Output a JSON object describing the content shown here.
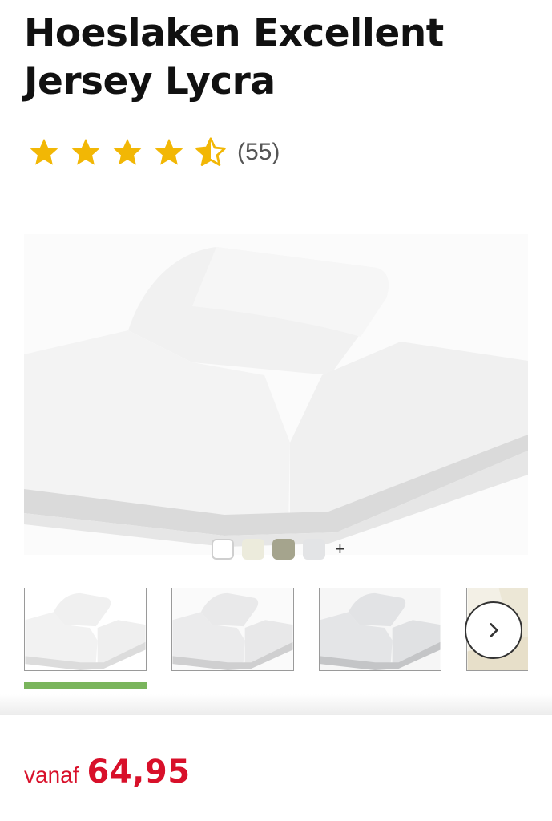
{
  "product": {
    "title_line_1": "Hoeslaken Excellent",
    "title_line_2": "Jersey Lycra"
  },
  "rating": {
    "stars": 4.5,
    "max_stars": 5,
    "count": "(55)",
    "star_color": "#f2b705"
  },
  "colors": {
    "swatches": [
      {
        "name": "white",
        "hex": "#ffffff",
        "selected": true
      },
      {
        "name": "cream",
        "hex": "#ecebdc"
      },
      {
        "name": "taupe",
        "hex": "#a5a48d"
      },
      {
        "name": "light-grey",
        "hex": "#e3e4e6"
      }
    ],
    "more_label": "+"
  },
  "gallery": {
    "thumbnail_count_visible": 4,
    "next_icon": "chevron-right-icon",
    "active_indicator_color": "#7ab55c"
  },
  "price": {
    "prefix": "vanaf",
    "value": "64,95",
    "color": "#d8102a"
  }
}
